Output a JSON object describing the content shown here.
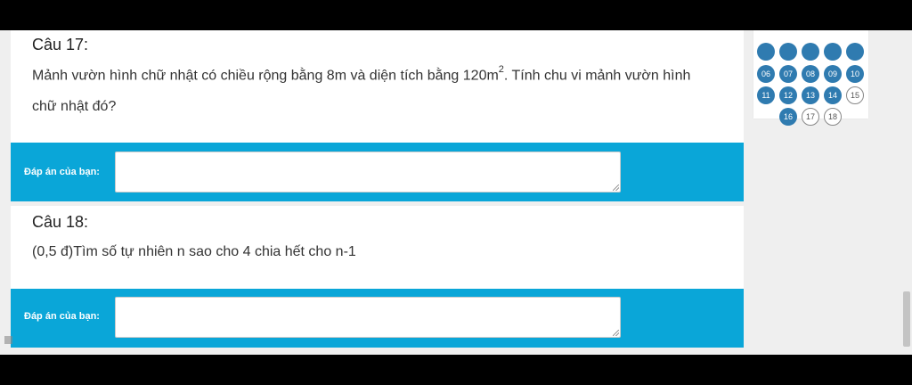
{
  "q17": {
    "title": "Câu 17:",
    "text_before": "Mảnh vườn hình chữ nhật có chiều rộng bằng 8m và diện tích bằng 120m",
    "text_sup": "2",
    "text_after": ". Tính chu vi mảnh vườn hình",
    "text_line2": "chữ nhật đó?",
    "answer_label": "Đáp án của bạn:",
    "answer_value": ""
  },
  "q18": {
    "title": "Câu 18:",
    "text": "(0,5 đ)Tìm số tự nhiên n sao cho 4 chia hết cho n-1",
    "answer_label": "Đáp án của bạn:",
    "answer_value": ""
  },
  "nav": {
    "row1": [
      "06",
      "07",
      "08",
      "09",
      "10"
    ],
    "row2": [
      "11",
      "12",
      "13",
      "14",
      "15"
    ],
    "row3": [
      "16",
      "17",
      "18"
    ],
    "answered": [
      "06",
      "07",
      "08",
      "09",
      "10",
      "11",
      "12",
      "13",
      "14",
      "16"
    ]
  },
  "colors": {
    "accent": "#0aa6d8",
    "answered": "#2f7bb0",
    "background": "#efefef"
  }
}
